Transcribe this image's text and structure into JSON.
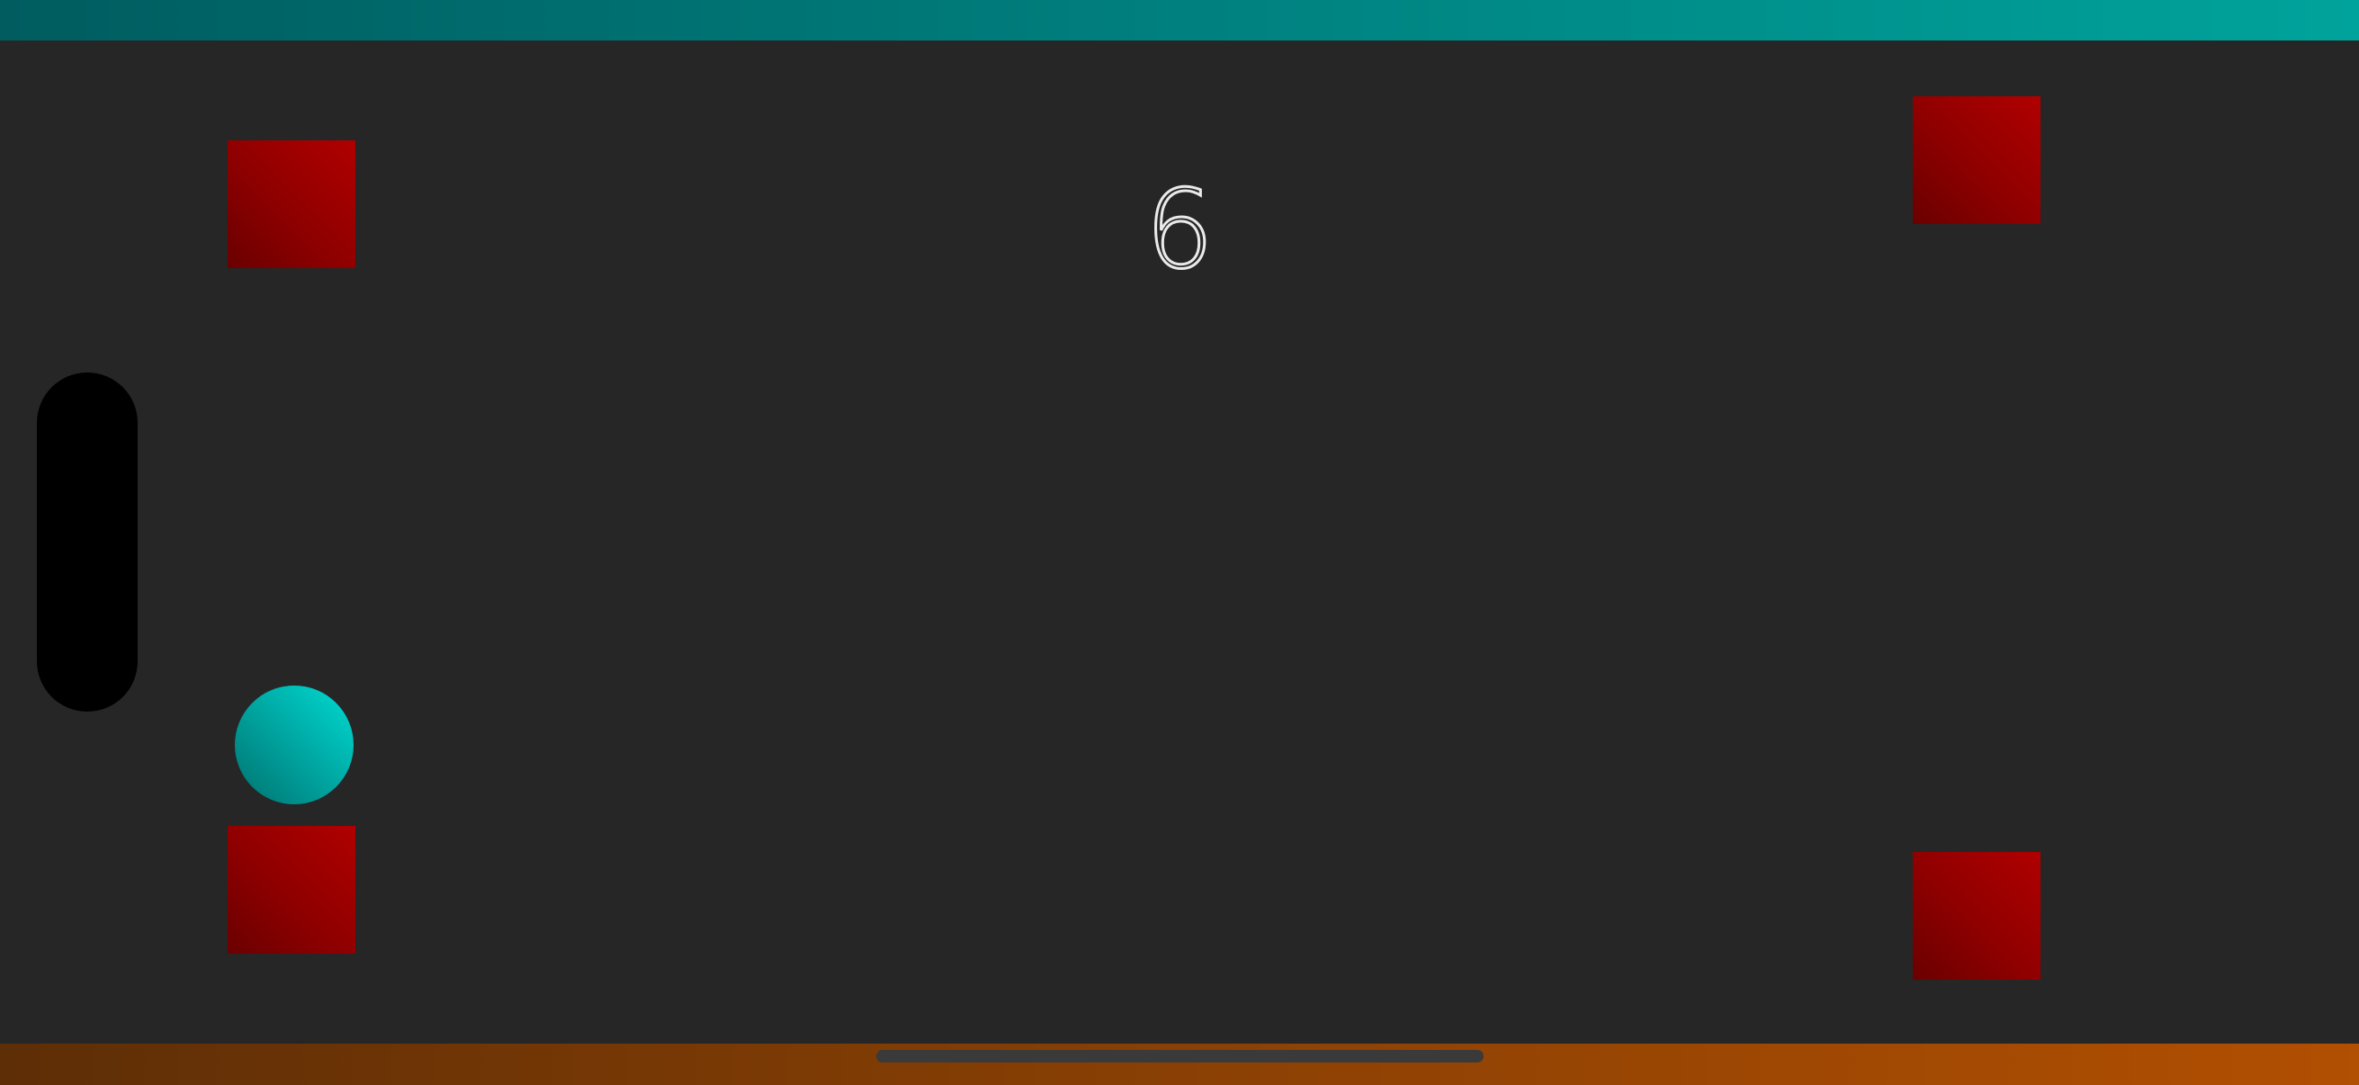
{
  "game": {
    "score": "6"
  },
  "colors": {
    "background": "#262626",
    "top_bar_gradient": [
      "#005c5f",
      "#00a39b"
    ],
    "bottom_bar_gradient": [
      "#5e2e06",
      "#b14f02"
    ],
    "block": "#a00000",
    "ball": "#00b3ad",
    "paddle": "#000000",
    "score_text": "#eaeaea"
  }
}
